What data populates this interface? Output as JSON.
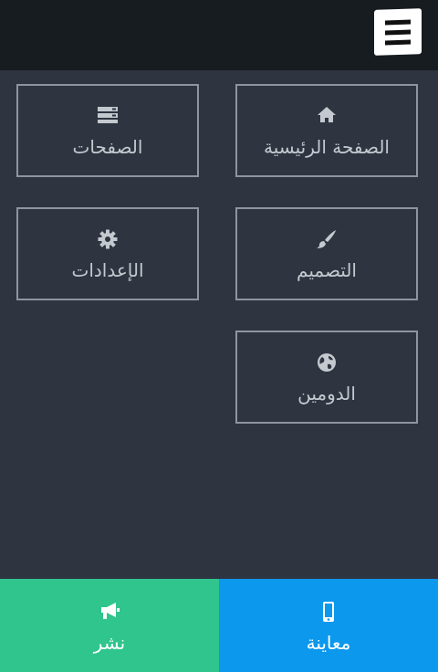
{
  "tiles": {
    "home": {
      "label": "الصفحة الرئيسية",
      "icon": "home-icon"
    },
    "pages": {
      "label": "الصفحات",
      "icon": "server-icon"
    },
    "design": {
      "label": "التصميم",
      "icon": "paint-brush-icon"
    },
    "settings": {
      "label": "الإعدادات",
      "icon": "gear-icon"
    },
    "domain": {
      "label": "الدومين",
      "icon": "globe-icon"
    }
  },
  "bottom": {
    "publish": {
      "label": "نشر",
      "icon": "megaphone-icon",
      "color": "#2fc58c"
    },
    "preview": {
      "label": "معاينة",
      "icon": "mobile-icon",
      "color": "#0c98ec"
    }
  },
  "colors": {
    "background": "#2f3540",
    "topbar": "#171c20",
    "tile_border": "#8f95a0"
  }
}
